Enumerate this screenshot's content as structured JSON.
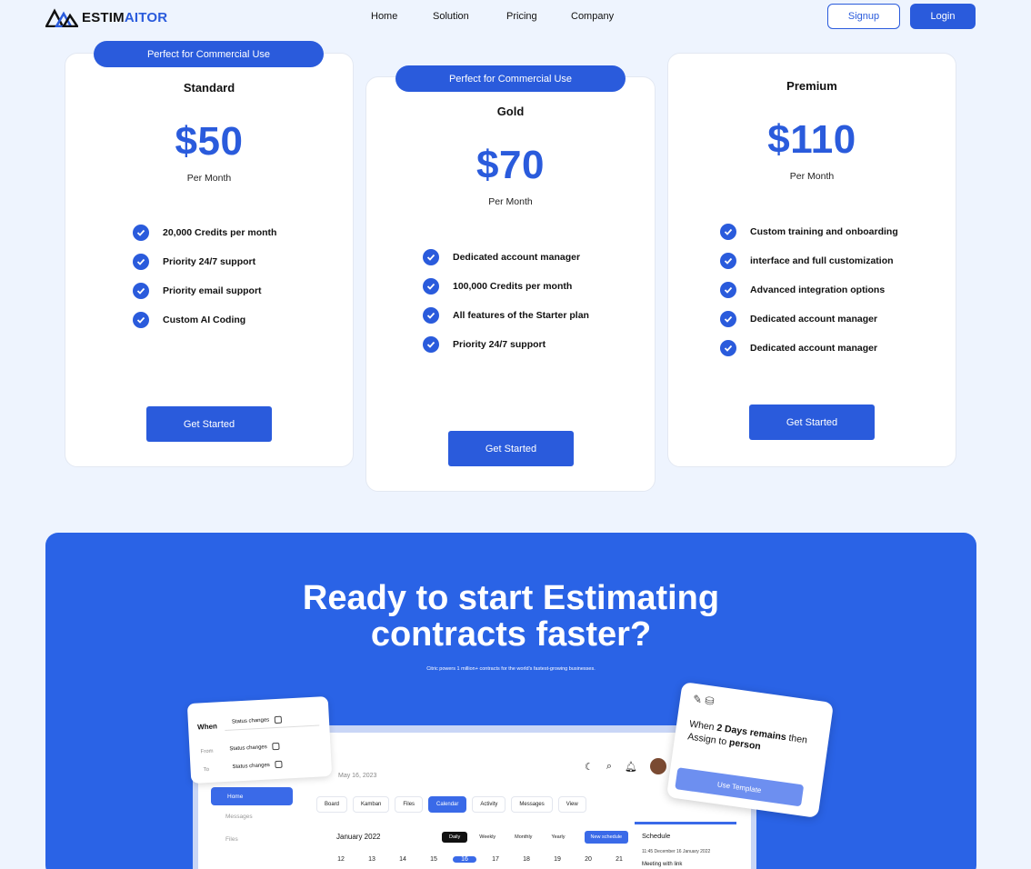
{
  "nav": {
    "logo_text_dark": "ESTIM",
    "logo_text_accent": "AITOR",
    "links": [
      "Home",
      "Solution",
      "Pricing",
      "Company"
    ],
    "signup": "Signup",
    "login": "Login"
  },
  "plans": [
    {
      "badge": "Perfect for Commercial Use",
      "name": "Standard",
      "price": "$50",
      "period": "Per Month",
      "features": [
        "20,000 Credits per month",
        "Priority 24/7 support",
        "Priority email support",
        "Custom AI Coding"
      ],
      "cta": "Get Started"
    },
    {
      "badge": "Perfect for Commercial Use",
      "name": "Gold",
      "price": "$70",
      "period": "Per Month",
      "features": [
        "Dedicated account manager",
        "100,000 Credits per month",
        "All features of the Starter plan",
        "Priority 24/7 support"
      ],
      "cta": "Get Started"
    },
    {
      "name": "Premium",
      "price": "$110",
      "period": "Per Month",
      "features": [
        "Custom training and onboarding",
        "interface and full customization",
        "Advanced integration options",
        "Dedicated account manager",
        "Dedicated account manager"
      ],
      "cta": "Get Started"
    }
  ],
  "hero": {
    "title_line1": "Ready to start Estimating",
    "title_line2": "contracts faster?",
    "subtitle": "Citric powers 1 million+ contracts for the world's fastest-growing businesses."
  },
  "mockup": {
    "date": "May 16, 2023",
    "sidebar": [
      "Home",
      "Messages",
      "Files"
    ],
    "tabs": [
      "Board",
      "Kamban",
      "Files",
      "Calendar",
      "Activity",
      "Messages",
      "View"
    ],
    "active_tab": "Calendar",
    "month": "January 2022",
    "views": [
      "Daily",
      "Weekly",
      "Monthly",
      "Yearly"
    ],
    "new_schedule": "New schedule",
    "days": [
      "12",
      "13",
      "14",
      "15",
      "16",
      "17",
      "18",
      "19",
      "20",
      "21"
    ],
    "active_day": "16",
    "schedule_title": "Schedule",
    "schedule_time": "11:45",
    "schedule_date": "December 16 January 2022",
    "schedule_item": "Meeting with link"
  },
  "when_card": {
    "when": "When",
    "when_value": "Status changes",
    "from": "From",
    "from_value": "Status changes",
    "to": "To",
    "to_value": "Status changes"
  },
  "days_card": {
    "text_pre": "When ",
    "text_bold": "2 Days remains",
    "text_mid": " then Assign to ",
    "text_bold2": "person",
    "button": "Use Template"
  },
  "colors": {
    "accent": "#2a5bdc",
    "hero_bg": "#2a63e6",
    "page_bg": "#eef4fe"
  }
}
